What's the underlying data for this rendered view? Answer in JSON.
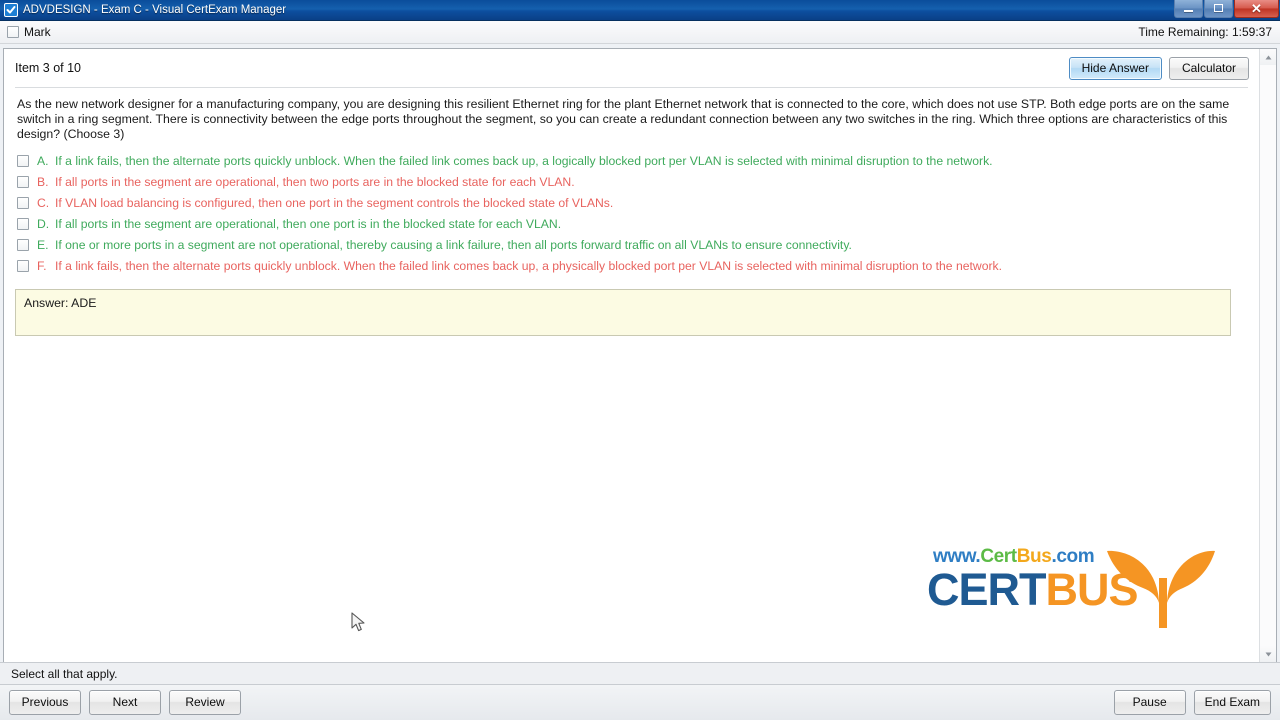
{
  "window": {
    "title": "ADVDESIGN - Exam C - Visual CertExam Manager",
    "app_icon": "checkbox-icon",
    "minimize_label": "Minimize",
    "maximize_label": "Maximize",
    "close_label": "Close"
  },
  "markbar": {
    "mark_label": "Mark",
    "timer_label": "Time Remaining: 1:59:37"
  },
  "header": {
    "item_counter": "Item 3 of 10",
    "hide_answer_label": "Hide Answer",
    "calculator_label": "Calculator"
  },
  "question": {
    "text": "As the new network designer for a manufacturing company, you are designing this resilient Ethernet ring for the plant Ethernet network that is connected to the core, which does not use STP. Both edge ports are on the same switch in a ring segment. There is connectivity between the edge ports throughout the segment, so you can create a redundant connection between any two switches in the ring. Which three options are characteristics of this design? (Choose 3)"
  },
  "options": [
    {
      "letter": "A.",
      "text": "If a link fails, then the alternate ports quickly unblock. When the failed link comes back up, a logically blocked port per VLAN is selected with minimal disruption to the network.",
      "state": "correct",
      "checked": false
    },
    {
      "letter": "B.",
      "text": "If all ports in the segment are operational, then two ports are in the blocked state for each VLAN.",
      "state": "wrong",
      "checked": false
    },
    {
      "letter": "C.",
      "text": "If VLAN load balancing is configured, then one port in the segment controls the blocked state of VLANs.",
      "state": "wrong",
      "checked": false
    },
    {
      "letter": "D.",
      "text": "If all ports in the segment are operational, then one port is in the blocked state for each VLAN.",
      "state": "correct",
      "checked": false
    },
    {
      "letter": "E.",
      "text": "If one or more ports in a segment are not operational, thereby causing a link failure, then all ports forward traffic on all VLANs to ensure connectivity.",
      "state": "correct",
      "checked": false
    },
    {
      "letter": "F.",
      "text": "If a link fails, then the alternate ports quickly unblock. When the failed link comes back up, a physically blocked port per VLAN is selected with minimal disruption to the network.",
      "state": "wrong",
      "checked": false
    }
  ],
  "answer": {
    "text": "Answer: ADE"
  },
  "logo": {
    "www": "www.",
    "cert": "Cert",
    "bus": "Bus",
    "com": ".com",
    "main_cert": "CERT",
    "main_bus": "BUS"
  },
  "status": {
    "text": "Select all that apply."
  },
  "footer": {
    "previous_label": "Previous",
    "next_label": "Next",
    "review_label": "Review",
    "pause_label": "Pause",
    "end_exam_label": "End Exam"
  },
  "colors": {
    "titlebar": "#0d4f9f",
    "correct": "#3faa5c",
    "wrong": "#e8635f",
    "answer_bg": "#fcfbe3",
    "accent_button": "#b2d9f4",
    "logo_blue": "#2f7ec4",
    "logo_green": "#5cbb46",
    "logo_orange": "#f59523",
    "logo_darkblue": "#1f5a92"
  }
}
